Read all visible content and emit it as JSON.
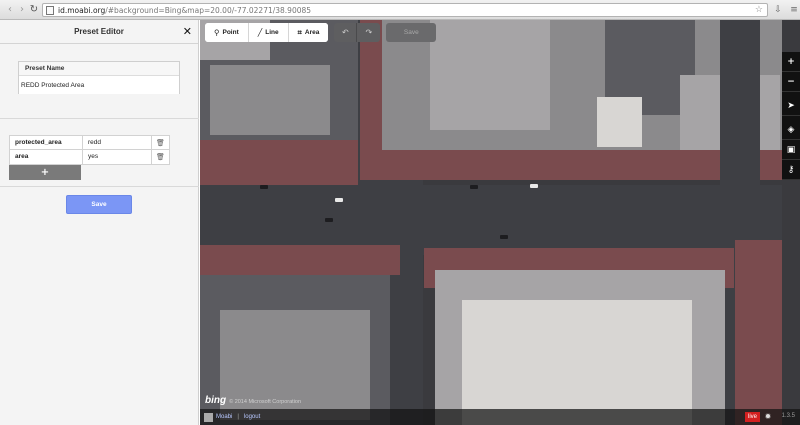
{
  "browser": {
    "url_host": "id.moabi.org",
    "url_path": "/#background=Bing&map=20.00/-77.02271/38.90085"
  },
  "panel": {
    "title": "Preset Editor",
    "preset_name_label": "Preset Name",
    "preset_name_value": "REDD Protected Area",
    "tags": [
      {
        "key": "protected_area",
        "value": "redd"
      },
      {
        "key": "area",
        "value": "yes"
      }
    ],
    "add_label": "+",
    "save_label": "Save"
  },
  "toolbar": {
    "point_label": "Point",
    "line_label": "Line",
    "area_label": "Area",
    "save_label": "Save"
  },
  "map": {
    "attribution_logo": "bing",
    "attribution_text": "© 2014 Microsoft Corporation"
  },
  "footer": {
    "user": "Moabi",
    "separator": "|",
    "logout_label": "logout",
    "live_label": "live",
    "version": "1.3.5"
  },
  "colors": {
    "save_button": "#7b96f5",
    "live_badge": "#d42020"
  }
}
